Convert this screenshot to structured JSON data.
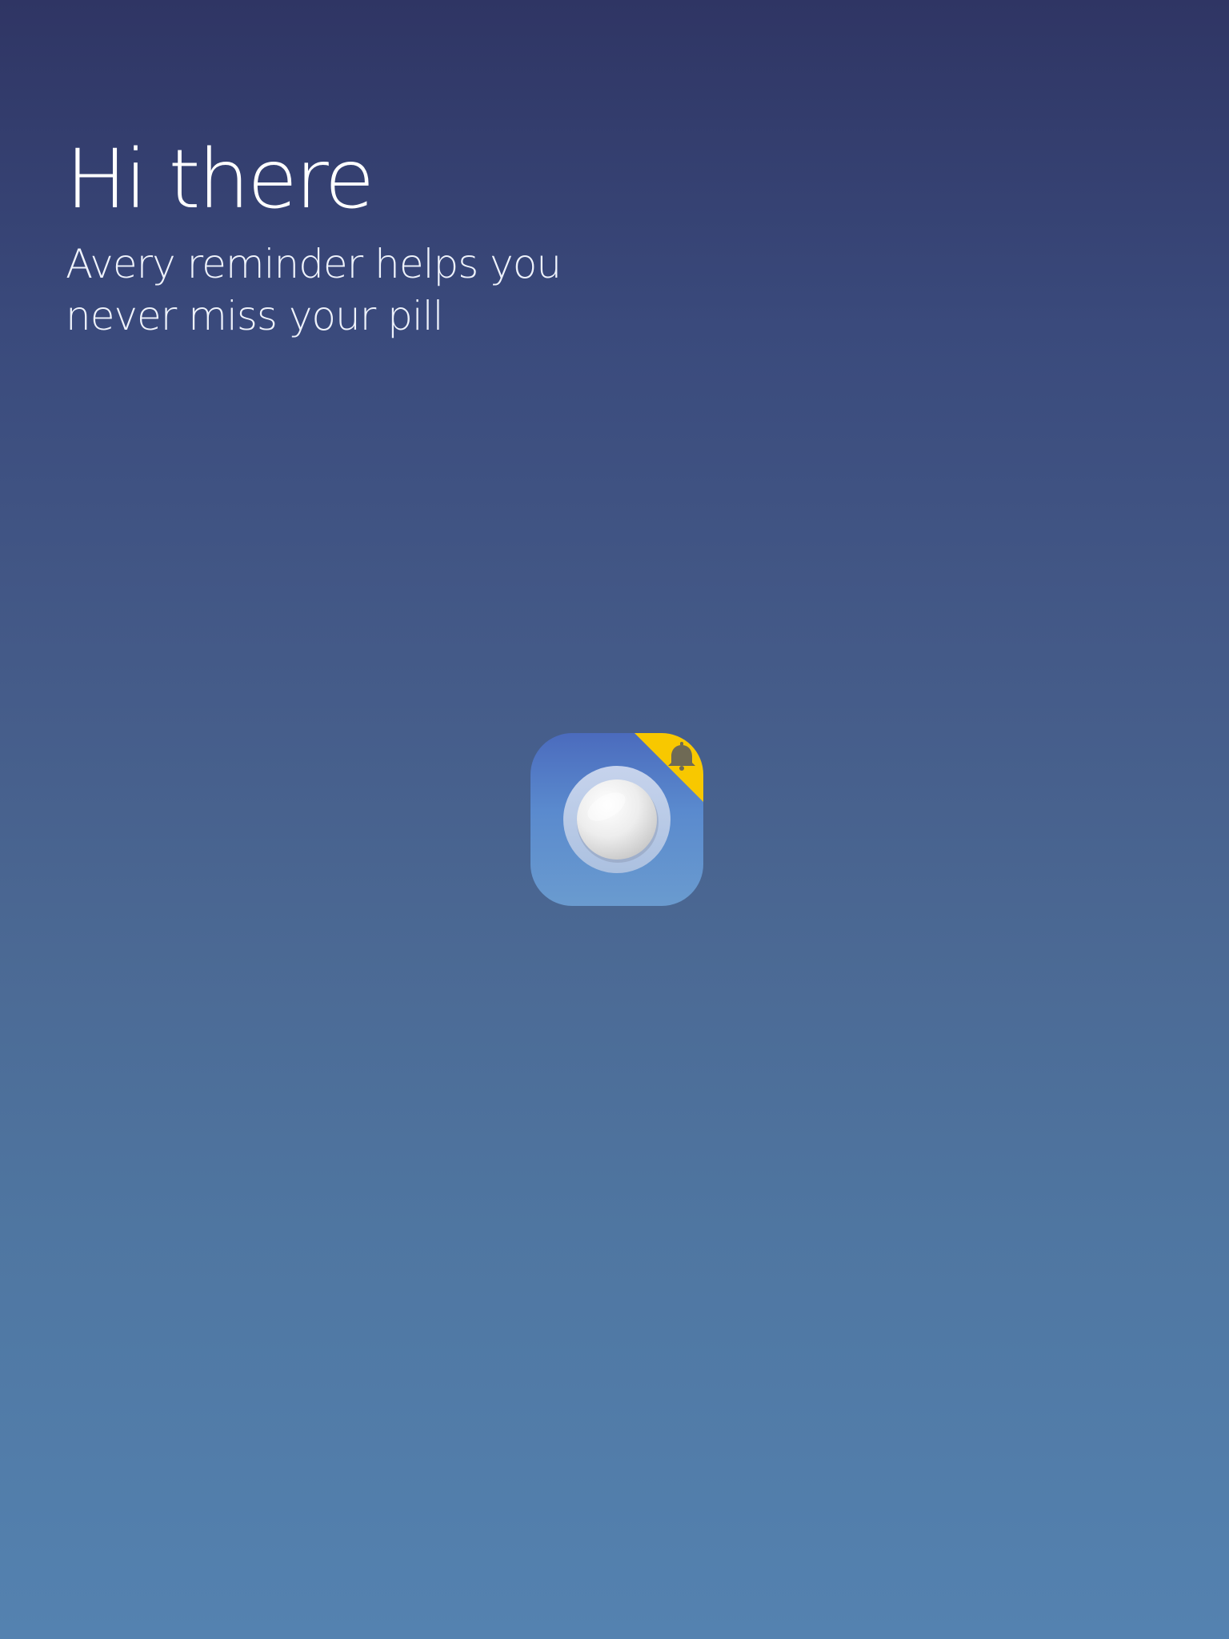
{
  "welcome": {
    "title": "Hi there",
    "subtitle": "Avery reminder helps you never miss your pill"
  },
  "app_icon": {
    "name": "pill-reminder-app-icon",
    "corner_icon": "bell-icon",
    "colors": {
      "icon_top": "#4b6bbd",
      "icon_bottom": "#6a9bcf",
      "corner_badge": "#f8c800",
      "bell": "#6f6a55"
    }
  },
  "theme": {
    "background_top": "#2f3564",
    "background_bottom": "#5482b0"
  }
}
